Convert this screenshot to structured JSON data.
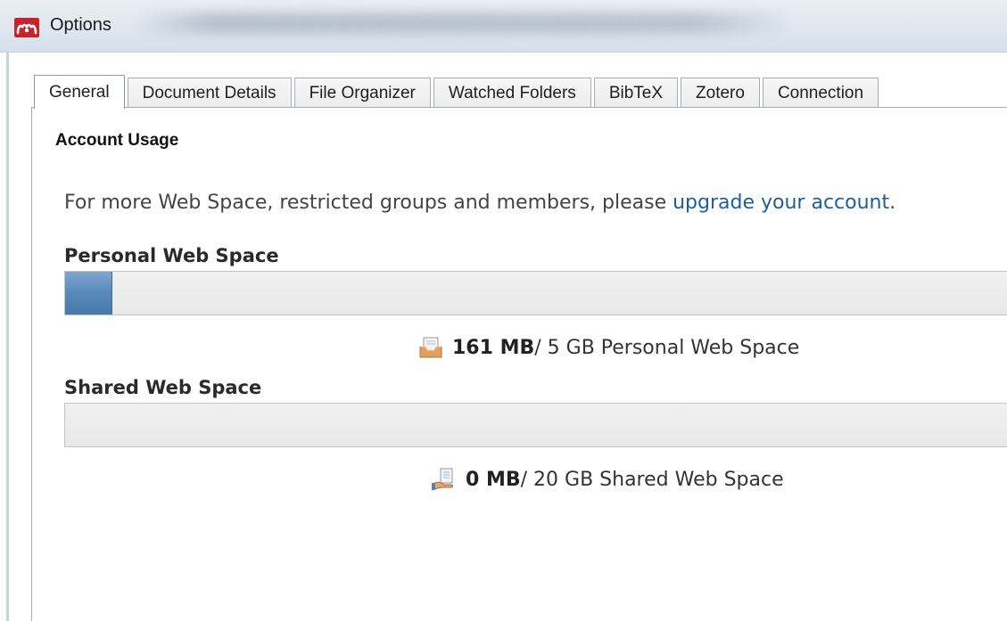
{
  "window": {
    "title": "Options"
  },
  "tabs": [
    {
      "label": "General",
      "active": true
    },
    {
      "label": "Document Details",
      "active": false
    },
    {
      "label": "File Organizer",
      "active": false
    },
    {
      "label": "Watched Folders",
      "active": false
    },
    {
      "label": "BibTeX",
      "active": false
    },
    {
      "label": "Zotero",
      "active": false
    },
    {
      "label": "Connection",
      "active": false
    }
  ],
  "account_usage": {
    "heading": "Account Usage",
    "info_prefix": "For more Web Space, restricted groups and members, please ",
    "info_link": "upgrade your account",
    "info_suffix": "."
  },
  "personal": {
    "label": "Personal Web Space",
    "used": "161 MB",
    "total_text": " / 5 GB Personal Web Space",
    "fill_fraction": 0.05,
    "icon": "personal-space-icon"
  },
  "shared": {
    "label": "Shared Web Space",
    "used": "0 MB",
    "total_text": " / 20 GB Shared Web Space",
    "fill_fraction": 0,
    "icon": "shared-space-icon"
  },
  "colors": {
    "accent": "#5b8bbd",
    "link": "#1d5f99",
    "brand": "#c8232c"
  }
}
